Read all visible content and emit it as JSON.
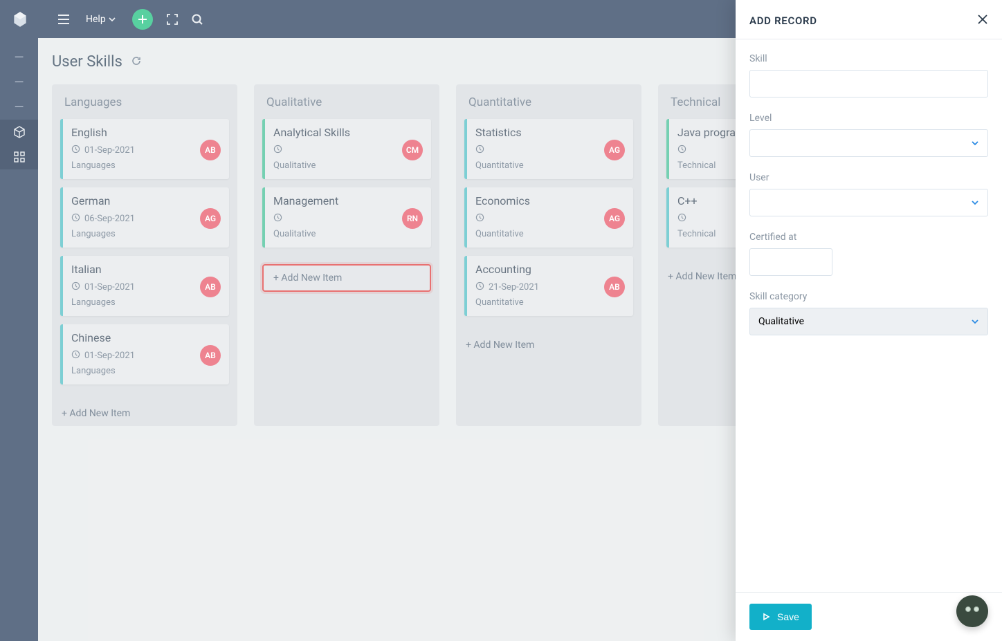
{
  "topbar": {
    "help_label": "Help"
  },
  "page": {
    "title": "User Skills"
  },
  "columns": [
    {
      "title": "Languages",
      "add_label": "+ Add New Item",
      "add_highlight": false,
      "cards": [
        {
          "title": "English",
          "date": "01-Sep-2021",
          "category": "Languages",
          "initials": "AB",
          "color": "teal"
        },
        {
          "title": "German",
          "date": "06-Sep-2021",
          "category": "Languages",
          "initials": "AG",
          "color": "teal"
        },
        {
          "title": "Italian",
          "date": "01-Sep-2021",
          "category": "Languages",
          "initials": "AB",
          "color": "teal"
        },
        {
          "title": "Chinese",
          "date": "01-Sep-2021",
          "category": "Languages",
          "initials": "AB",
          "color": "teal"
        }
      ]
    },
    {
      "title": "Qualitative",
      "add_label": "+ Add New Item",
      "add_highlight": true,
      "cards": [
        {
          "title": "Analytical Skills",
          "date": "",
          "category": "Qualitative",
          "initials": "CM",
          "color": "green"
        },
        {
          "title": "Management",
          "date": "",
          "category": "Qualitative",
          "initials": "RN",
          "color": "green"
        }
      ]
    },
    {
      "title": "Quantitative",
      "add_label": "+ Add New Item",
      "add_highlight": false,
      "cards": [
        {
          "title": "Statistics",
          "date": "",
          "category": "Quantitative",
          "initials": "AG",
          "color": "teal"
        },
        {
          "title": "Economics",
          "date": "",
          "category": "Quantitative",
          "initials": "AG",
          "color": "teal"
        },
        {
          "title": "Accounting",
          "date": "21-Sep-2021",
          "category": "Quantitative",
          "initials": "AB",
          "color": "teal"
        }
      ]
    },
    {
      "title": "Technical",
      "add_label": "+ Add New Item",
      "add_highlight": false,
      "cards": [
        {
          "title": "Java programming",
          "date": "",
          "category": "Technical",
          "initials": "",
          "color": "green"
        },
        {
          "title": "C++",
          "date": "",
          "category": "Technical",
          "initials": "",
          "color": "teal"
        }
      ]
    }
  ],
  "sidepanel": {
    "title": "ADD RECORD",
    "fields": {
      "skill_label": "Skill",
      "level_label": "Level",
      "user_label": "User",
      "certified_label": "Certified at",
      "category_label": "Skill category",
      "category_value": "Qualitative"
    },
    "save_label": "Save"
  }
}
